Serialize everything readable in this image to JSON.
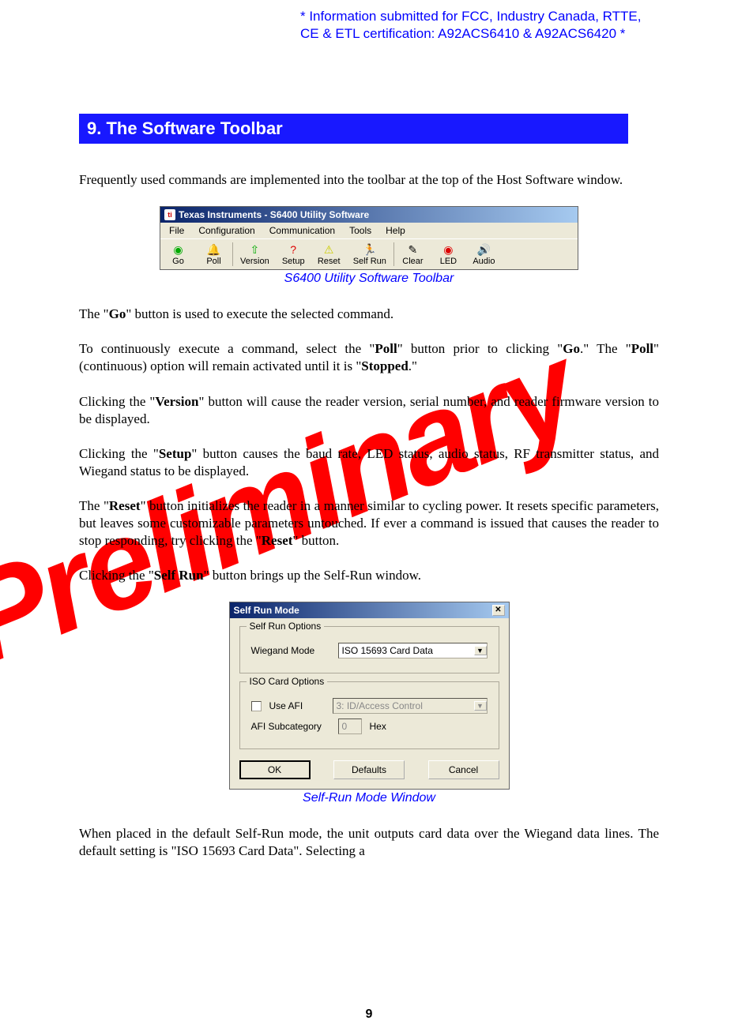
{
  "header_note": "* Information submitted for FCC, Industry Canada, RTTE, CE & ETL certification: A92ACS6410 & A92ACS6420 *",
  "section_title": "9. The Software Toolbar",
  "intro": "Frequently used commands are implemented into the toolbar at the top of the Host Software window.",
  "toolbar": {
    "title": "Texas Instruments - S6400 Utility Software",
    "menus": [
      "File",
      "Configuration",
      "Communication",
      "Tools",
      "Help"
    ],
    "buttons": [
      "Go",
      "Poll",
      "Version",
      "Setup",
      "Reset",
      "Self Run",
      "Clear",
      "LED",
      "Audio"
    ]
  },
  "caption1": "S6400 Utility Software Toolbar",
  "p_go_a": "The \"",
  "p_go_b": "Go",
  "p_go_c": "\" button is used to execute the selected command.",
  "p_poll_a": "To continuously execute a command, select the \"",
  "p_poll_b": "Poll",
  "p_poll_c": "\" button prior to clicking \"",
  "p_poll_d": "Go",
  "p_poll_e": ".\"  The \"",
  "p_poll_f": "Poll",
  "p_poll_g": "\" (continuous) option will remain activated until it is \"",
  "p_poll_h": "Stopped",
  "p_poll_i": ".\"",
  "p_ver_a": "Clicking the \"",
  "p_ver_b": "Version",
  "p_ver_c": "\" button will cause the reader version, serial number, and reader firmware version to be displayed.",
  "p_set_a": "Clicking the \"",
  "p_set_b": "Setup",
  "p_set_c": "\" button causes the baud rate, LED status, audio status, RF transmitter status, and Wiegand status to be displayed.",
  "p_rst_a": "The \"",
  "p_rst_b": "Reset",
  "p_rst_c": "\" button initializes the reader in a manner similar to cycling power.  It resets specific parameters, but leaves some customizable parameters untouched.  If ever a command is issued that causes the reader to stop responding, try clicking the \"",
  "p_rst_d": "Reset",
  "p_rst_e": "\" button.",
  "p_sr_a": "Clicking the \"",
  "p_sr_b": "Self Run",
  "p_sr_c": "\" button brings up the Self-Run window.",
  "dialog": {
    "title": "Self Run Mode",
    "group1": "Self Run Options",
    "wiegand_label": "Wiegand Mode",
    "wiegand_value": "ISO 15693 Card Data",
    "group2": "ISO Card Options",
    "useafi_label": "Use AFI",
    "afi_combo": "3: ID/Access Control",
    "afisub_label": "AFI Subcategory",
    "afisub_value": "0",
    "afisub_hex": "Hex",
    "ok": "OK",
    "defaults": "Defaults",
    "cancel": "Cancel"
  },
  "caption2": "Self-Run Mode Window",
  "p_last": "When placed in the default Self-Run mode, the unit outputs card data over the Wiegand data lines.  The default setting is \"ISO 15693 Card Data\".  Selecting a",
  "page_num": "9",
  "watermark": "Preliminary"
}
